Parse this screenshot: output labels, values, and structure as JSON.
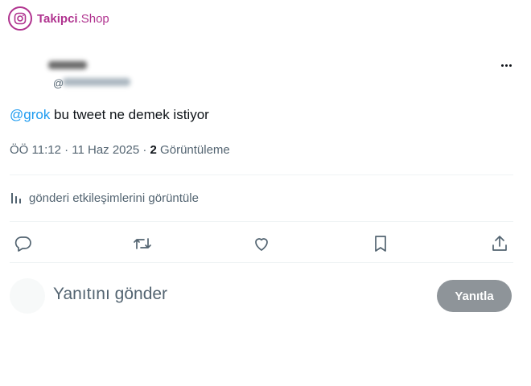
{
  "watermark": {
    "brand": "Takipci",
    "suffix": ".Shop",
    "icon": "instagram-icon",
    "color": "#b0338f"
  },
  "post": {
    "handle_prefix": "@",
    "more_icon": "more-dots-icon",
    "mention": "@grok",
    "text": " bu tweet ne demek istiyor",
    "timestamp": "ÖÖ 11:12 · 11 Haz 2025 · ",
    "views_count": "2",
    "views_label": " Görüntüleme",
    "analytics_label": "gönderi etkileşimlerini görüntüle",
    "analytics_icon": "analytics-icon",
    "actions": [
      {
        "icon": "reply-icon"
      },
      {
        "icon": "retweet-icon"
      },
      {
        "icon": "like-icon"
      },
      {
        "icon": "bookmark-icon"
      },
      {
        "icon": "share-icon"
      }
    ]
  },
  "reply": {
    "placeholder": "Yanıtını gönder",
    "button_label": "Yanıtla"
  },
  "colors": {
    "accent": "#1d9bf0",
    "muted": "#536471",
    "text": "#0f1419",
    "button_disabled": "#8e9499"
  }
}
